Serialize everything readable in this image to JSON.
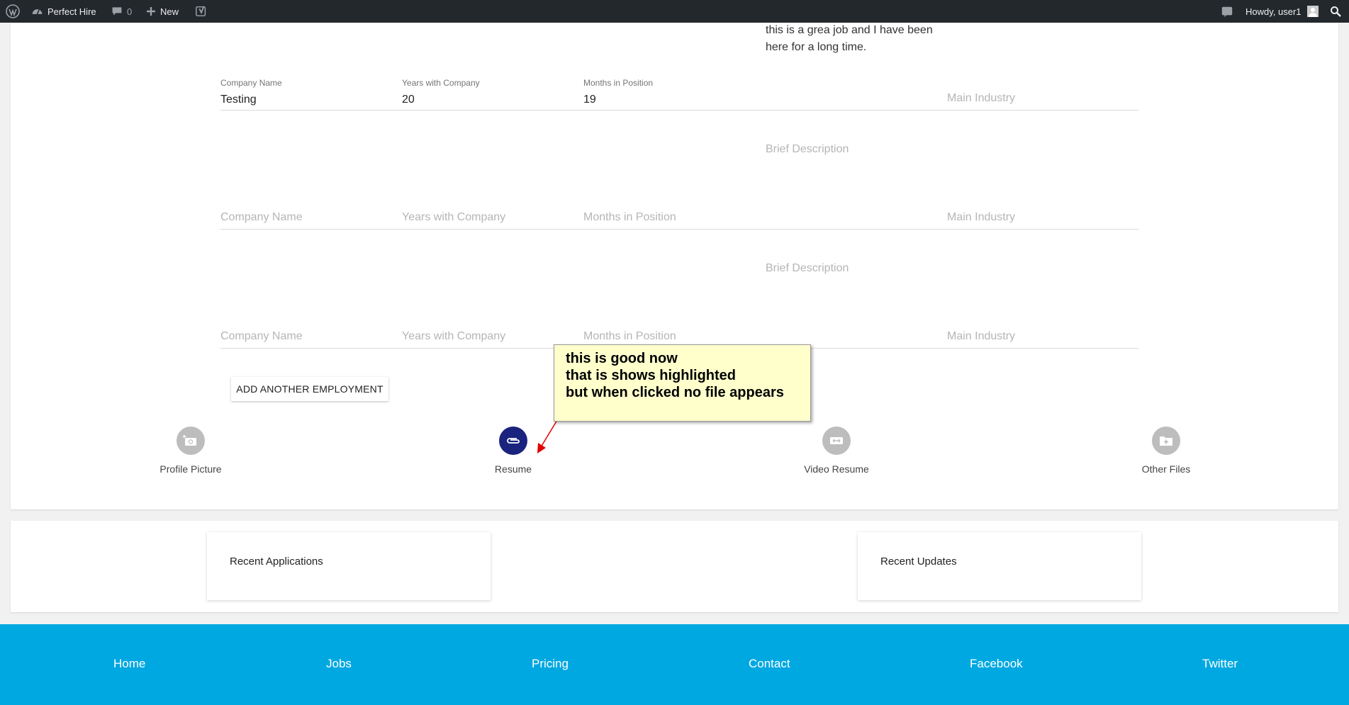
{
  "adminbar": {
    "site_name": "Perfect Hire",
    "comments_count": "0",
    "new_label": "New",
    "howdy": "Howdy, user1"
  },
  "employment": {
    "prev_description": [
      "this is a grea job and I have been",
      "here for a long time."
    ],
    "filled": {
      "company_label": "Company Name",
      "years_label": "Years with Company",
      "months_label": "Months in Position",
      "company_value": "Testing",
      "years_value": "20",
      "months_value": "19",
      "industry_placeholder": "Main Industry"
    },
    "placeholders": {
      "description": "Brief Description",
      "company": "Company Name",
      "years": "Years with Company",
      "months": "Months in Position",
      "industry": "Main Industry"
    },
    "add_button": "ADD ANOTHER EMPLOYMENT"
  },
  "uploads": [
    {
      "label": "Profile Picture",
      "icon": "camera-plus-icon",
      "active": false
    },
    {
      "label": "Resume",
      "icon": "paperclip-icon",
      "active": true
    },
    {
      "label": "Video Resume",
      "icon": "video-camera-icon",
      "active": false
    },
    {
      "label": "Other Files",
      "icon": "folder-plus-icon",
      "active": false
    }
  ],
  "annotation": {
    "lines": [
      "this is good now",
      "that is shows highlighted",
      "but when clicked no file appears"
    ]
  },
  "recent": {
    "applications_title": "Recent Applications",
    "updates_title": "Recent Updates"
  },
  "footer": {
    "links": [
      "Home",
      "Jobs",
      "Pricing",
      "Contact",
      "Facebook",
      "Twitter"
    ]
  },
  "colors": {
    "adminbar_bg": "#23282d",
    "accent_active": "#1a237e",
    "icon_inactive": "#bdbdbd",
    "footer_bg": "#00a8e1",
    "callout_bg": "#ffffcc",
    "arrow": "#e00000"
  }
}
